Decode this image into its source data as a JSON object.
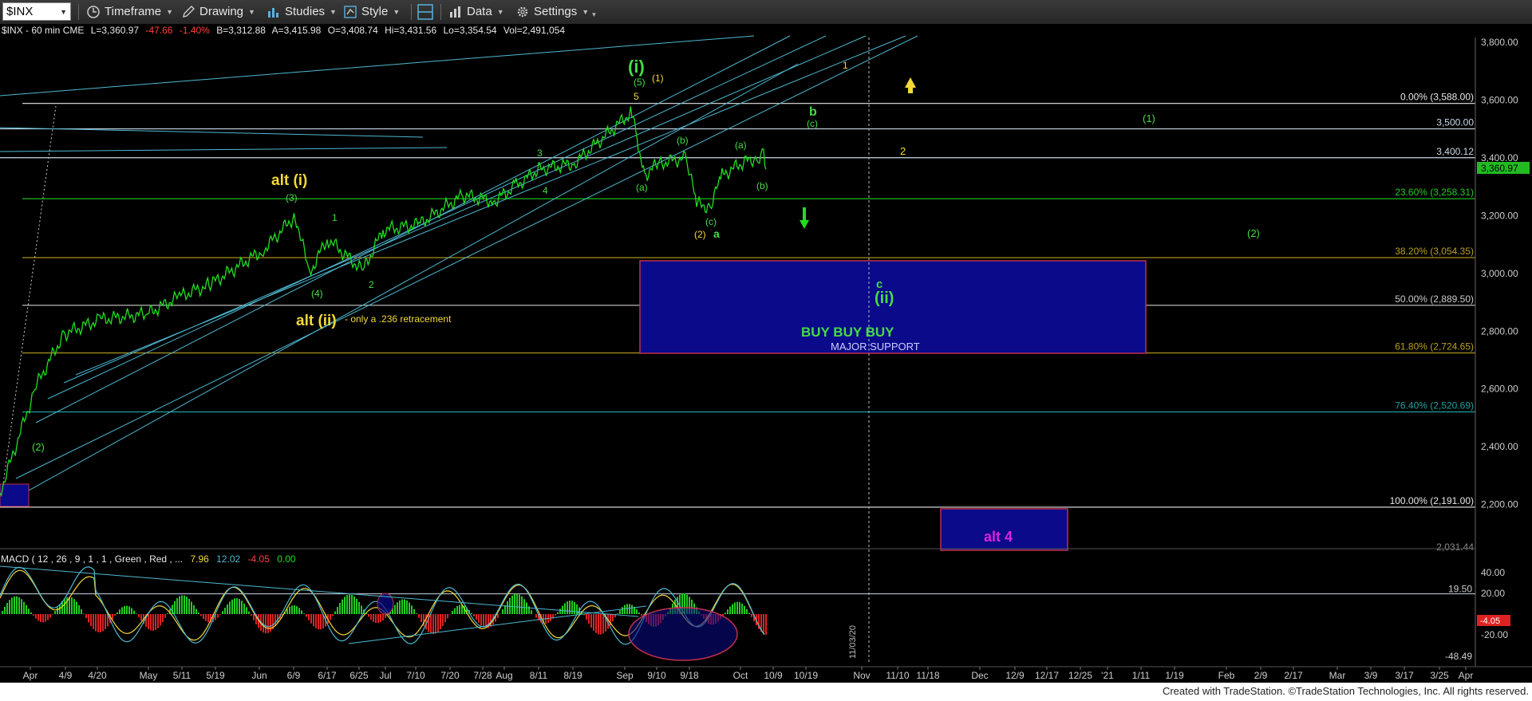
{
  "toolbar": {
    "symbol": "$INX",
    "timeframe": "Timeframe",
    "drawing": "Drawing",
    "studies": "Studies",
    "style": "Style",
    "data": "Data",
    "settings": "Settings"
  },
  "chart_header": "$INX - 60 min  CME",
  "quote": {
    "last": "L=3,360.97",
    "change": "-47.66",
    "pct": "-1.40%",
    "bid": "B=3,312.88",
    "ask": "A=3,415.98",
    "open": "O=3,408.74",
    "high": "Hi=3,431.56",
    "low": "Lo=3,354.54",
    "volume": "Vol=2,491,054"
  },
  "footer": "Created with TradeStation. ©TradeStation Technologies, Inc. All rights reserved.",
  "colors": {
    "price": "#22dd22",
    "channel": "#4fb8d0",
    "wave_yellow": "#f4d838",
    "wave_green": "#44dd44",
    "box_fill": "#0a0a8a",
    "box_border": "#c0304a",
    "alt4": "#dd22dd"
  },
  "chart_data": {
    "type": "line",
    "title": "$INX - 60 min CME",
    "series": [
      {
        "name": "$INX",
        "x": [
          "3/23",
          "4/1",
          "4/9",
          "4/20",
          "5/1",
          "5/11",
          "5/19",
          "6/1",
          "6/9",
          "6/12",
          "6/17",
          "6/25",
          "7/1",
          "7/10",
          "7/20",
          "7/28",
          "8/3",
          "8/11",
          "8/19",
          "9/2",
          "9/4",
          "9/8",
          "9/10",
          "9/16",
          "9/21",
          "9/24",
          "9/29",
          "10/6",
          "10/9",
          "10/12",
          "10/14"
        ],
        "values": [
          2240,
          2610,
          2790,
          2840,
          2860,
          2920,
          2960,
          3080,
          3200,
          3000,
          3120,
          3010,
          3150,
          3170,
          3270,
          3250,
          3300,
          3360,
          3380,
          3560,
          3440,
          3340,
          3380,
          3400,
          3240,
          3230,
          3340,
          3390,
          3400,
          3420,
          3360
        ]
      }
    ],
    "xlabel": "",
    "ylabel": "",
    "ylim": [
      1960,
      3840
    ],
    "x_tick_labels": [
      "Apr",
      "4/9",
      "4/20",
      "May",
      "5/11",
      "5/19",
      "Jun",
      "6/9",
      "6/17",
      "6/25",
      "Jul",
      "7/10",
      "7/20",
      "7/28",
      "Aug",
      "8/11",
      "8/19",
      "Sep",
      "9/10",
      "9/18",
      "Oct",
      "10/9",
      "10/19",
      "Nov",
      "11/10",
      "11/18",
      "Dec",
      "12/9",
      "12/17",
      "12/25",
      "'21",
      "1/11",
      "1/19",
      "Feb",
      "2/9",
      "2/17",
      "Mar",
      "3/9",
      "3/17",
      "3/25",
      "Apr"
    ],
    "y_ticks": [
      "3,800.00",
      "3,600.00",
      "3,400.00",
      "3,200.00",
      "3,000.00",
      "2,800.00",
      "2,600.00",
      "2,400.00",
      "2,200.00"
    ],
    "last_price_label": "3,360.97",
    "horizontal_levels": [
      {
        "label": "0.00% (3,588.00)",
        "value": 3588
      },
      {
        "label": "3,500.00",
        "value": 3500
      },
      {
        "label": "3,400.12",
        "value": 3400.12
      },
      {
        "label": "23.60% (3,258.31)",
        "value": 3258.31
      },
      {
        "label": "38.20% (3,054.35)",
        "value": 3054.35
      },
      {
        "label": "50.00% (2,889.50)",
        "value": 2889.5
      },
      {
        "label": "61.80% (2,724.65)",
        "value": 2724.65
      },
      {
        "label": "76.40% (2,520.69)",
        "value": 2520.69
      },
      {
        "label": "100.00% (2,191.00)",
        "value": 2191
      },
      {
        "label": "2,031.44",
        "value": 2031.44
      }
    ],
    "vertical_marker": "11/03/20",
    "annotations": {
      "alt_i": "alt (i)",
      "alt_ii": "alt (ii)",
      "alt_ii_note": "- only a .236 retracement",
      "wave_i": "(i)",
      "wave_ii": "(ii)",
      "wave_c": "c",
      "wave_b": "b",
      "wave_a": "a",
      "buy": "BUY BUY BUY",
      "support": "MAJOR SUPPORT",
      "alt4": "alt 4",
      "lbl_1": "1",
      "lbl_2": "2",
      "lbl_3": "3",
      "lbl_4": "4",
      "lbl_5": "5",
      "lbl_p1": "(1)",
      "lbl_p2": "(2)",
      "lbl_p3": "(3)",
      "lbl_p4": "(4)",
      "lbl_p5": "(5)",
      "lbl_pa": "(a)",
      "lbl_pb": "(b)",
      "lbl_pc": "(c)"
    }
  },
  "macd": {
    "header": "MACD ( 12 , 26 , 9 , 1 , 1 , Green , Red , ...",
    "v1": "7.96",
    "v2": "12.02",
    "v3": "-4.05",
    "v4": "0.00",
    "y_ticks": [
      "40.00",
      "20.00",
      "-20.00"
    ],
    "level_label": "19.50",
    "low_label": "-48.49",
    "current_label": "-4.05"
  }
}
